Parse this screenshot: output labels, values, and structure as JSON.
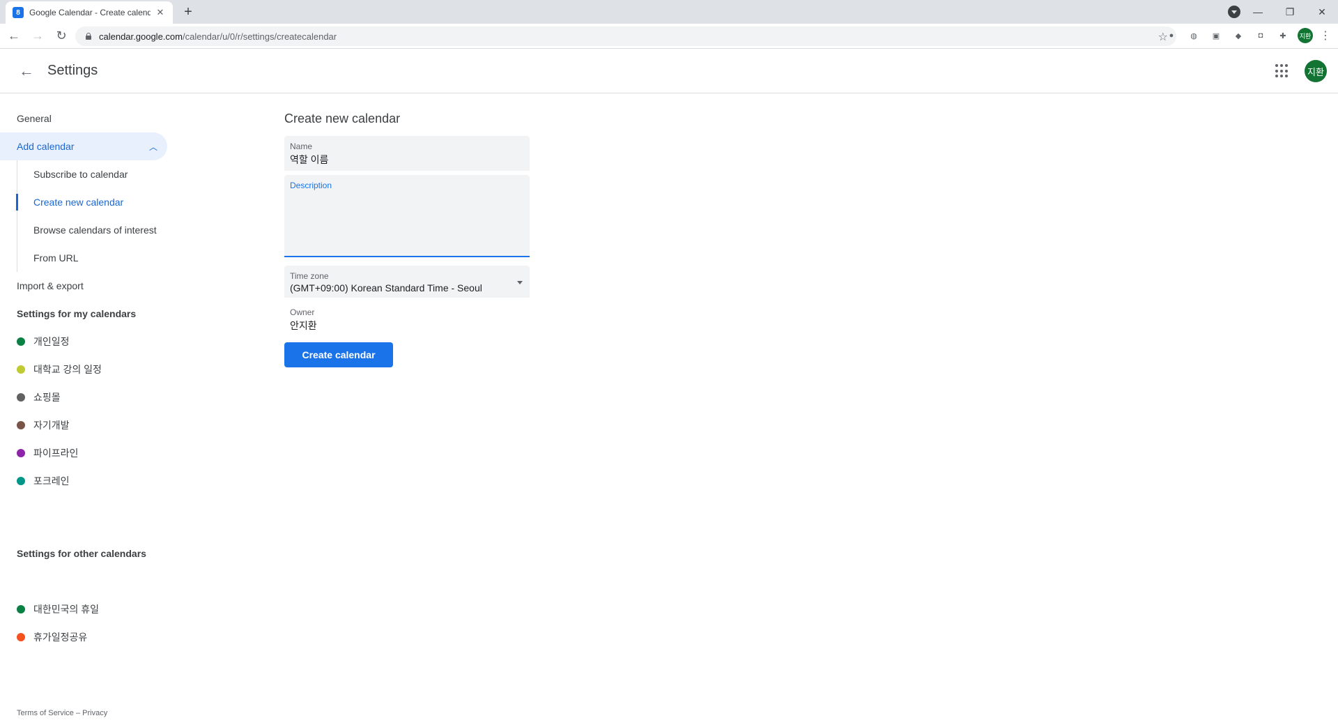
{
  "browser": {
    "tab_title": "Google Calendar - Create calendar",
    "tab_favicon": "8",
    "url_host": "calendar.google.com",
    "url_path": "/calendar/u/0/r/settings/createcalendar",
    "extension_avatar": "지환"
  },
  "header": {
    "title": "Settings",
    "avatar": "지환"
  },
  "sidebar": {
    "general": "General",
    "add_calendar": "Add calendar",
    "sub_items": [
      "Subscribe to calendar",
      "Create new calendar",
      "Browse calendars of interest",
      "From URL"
    ],
    "import_export": "Import & export",
    "my_calendars_heading": "Settings for my calendars",
    "my_calendars": [
      {
        "name": "개인일정",
        "color": "#0b8043"
      },
      {
        "name": "대학교 강의 일정",
        "color": "#c0ca33"
      },
      {
        "name": "쇼핑몰",
        "color": "#616161"
      },
      {
        "name": "자기개발",
        "color": "#795548"
      },
      {
        "name": "파이프라인",
        "color": "#8e24aa"
      },
      {
        "name": "포크레인",
        "color": "#009688"
      }
    ],
    "other_calendars_heading": "Settings for other calendars",
    "other_calendars": [
      {
        "name": "대한민국의 휴일",
        "color": "#0b8043"
      },
      {
        "name": "휴가일정공유",
        "color": "#f4511e"
      }
    ],
    "footer": "Terms of Service – Privacy"
  },
  "form": {
    "title": "Create new calendar",
    "name_label": "Name",
    "name_value": "역할 이름",
    "description_label": "Description",
    "description_value": "",
    "timezone_label": "Time zone",
    "timezone_value": "(GMT+09:00) Korean Standard Time - Seoul",
    "owner_label": "Owner",
    "owner_value": "안지환",
    "create_button": "Create calendar"
  },
  "colors": {
    "accent": "#1a73e8",
    "active_text": "#1967d2",
    "active_bg": "#e8f0fe"
  }
}
